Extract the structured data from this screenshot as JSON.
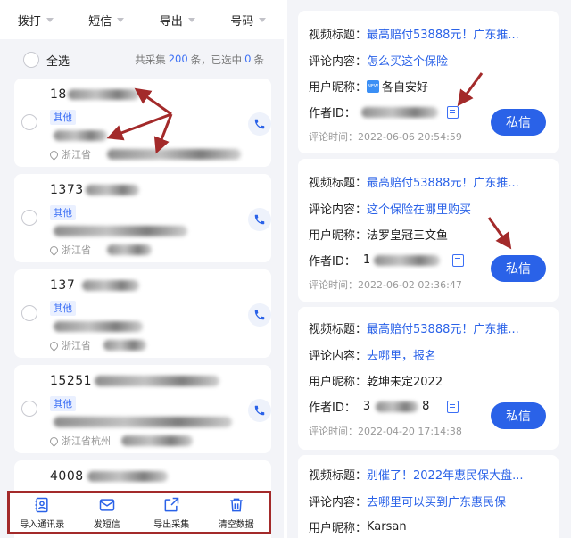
{
  "left": {
    "tabs": [
      {
        "label": "拨打"
      },
      {
        "label": "短信"
      },
      {
        "label": "导出"
      },
      {
        "label": "号码"
      }
    ],
    "select_all": "全选",
    "stat_prefix": "共采集",
    "stat_total": "200",
    "stat_mid": "条，已选中",
    "stat_selected": "0",
    "stat_suffix": "条",
    "cards": [
      {
        "phone": "18",
        "tag": "其他",
        "loc": "浙江省"
      },
      {
        "phone": "1373",
        "tag": "其他",
        "loc": "浙江省"
      },
      {
        "phone": "137",
        "tag": "其他",
        "loc": "浙江省"
      },
      {
        "phone": "15251",
        "tag": "其他",
        "loc": "浙江省杭州"
      },
      {
        "phone": "4008",
        "tag": "",
        "loc": ""
      }
    ],
    "bottom": [
      {
        "label": "导入通讯录",
        "icon": "contacts-import-icon"
      },
      {
        "label": "发短信",
        "icon": "mail-icon"
      },
      {
        "label": "导出采集",
        "icon": "export-icon"
      },
      {
        "label": "清空数据",
        "icon": "trash-icon"
      }
    ],
    "highlight_color": "#a32a2a"
  },
  "right": {
    "labels": {
      "title": "视频标题：",
      "comment": "评论内容：",
      "nickname": "用户昵称：",
      "author": "作者ID：",
      "time": "评论时间：",
      "message": "私信"
    },
    "cards": [
      {
        "title": "最高赔付53888元！广东推...",
        "comment": "怎么买这个保险",
        "nickname": "各自安好",
        "author_id": "",
        "time": "2022-06-06 20:54:59",
        "badge": "NEW"
      },
      {
        "title": "最高赔付53888元！广东推...",
        "comment": "这个保险在哪里购买",
        "nickname": "法罗皇冠三文鱼",
        "author_id": "1",
        "time": "2022-06-02 02:36:47"
      },
      {
        "title": "最高赔付53888元！广东推...",
        "comment": "去哪里，报名",
        "nickname": "乾坤未定2022",
        "author_id": "3",
        "author_suffix": "8",
        "time": "2022-04-20 17:14:38"
      },
      {
        "title": "别催了！2022年惠民保大盘...",
        "comment": "去哪里可以买到广东惠民保",
        "nickname": "Karsan"
      }
    ],
    "accent": "#2a62e8"
  }
}
